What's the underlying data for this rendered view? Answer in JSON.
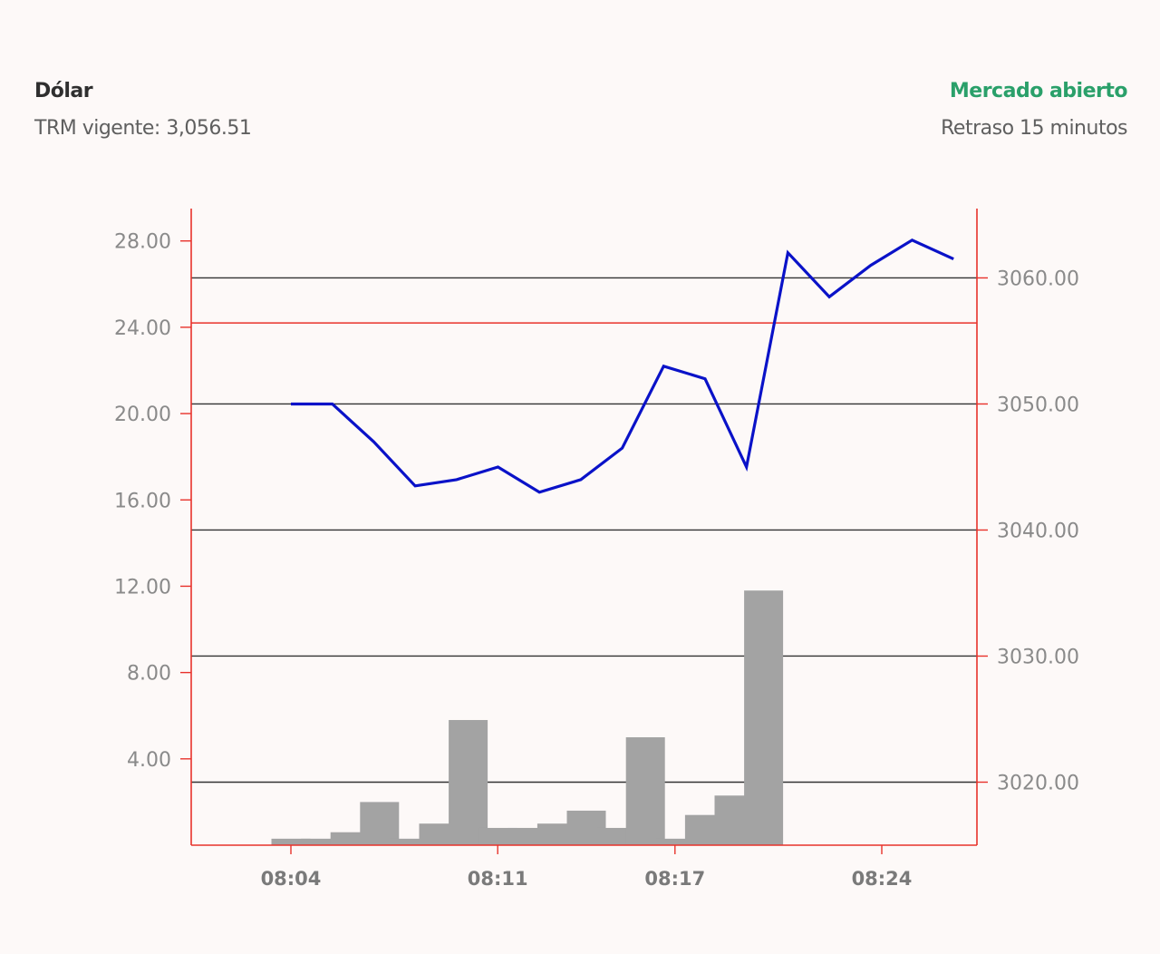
{
  "header": {
    "title": "Dólar",
    "trm": "TRM vigente: 3,056.51",
    "status": "Mercado abierto",
    "delay": "Retraso 15 minutos"
  },
  "colors": {
    "status": "#2aa06a",
    "line": "#0a12c8",
    "bars": "#a3a3a3",
    "axis": "#e8322b",
    "grid": "#333333",
    "tick_text": "#8a8a8a"
  },
  "chart_data": {
    "type": "bar+line",
    "x": [
      "08:04",
      "08:05",
      "08:06",
      "08:07",
      "08:08",
      "08:09",
      "08:10",
      "08:11",
      "08:12",
      "08:13",
      "08:14",
      "08:15",
      "08:16",
      "08:17",
      "08:18",
      "08:19",
      "08:20",
      "08:21",
      "08:22",
      "08:23",
      "08:24",
      "08:25"
    ],
    "x_tick_labels": [
      "08:04",
      "08:11",
      "08:17",
      "08:24"
    ],
    "bars": {
      "axis": "left",
      "x": [
        "08:04",
        "08:05",
        "08:06",
        "08:07",
        "08:08",
        "08:09",
        "08:10",
        "08:11",
        "08:12",
        "08:13",
        "08:14",
        "08:15",
        "08:16",
        "08:17",
        "08:18",
        "08:19",
        "08:20",
        "08:21",
        "08:22",
        "08:23"
      ],
      "values": [
        0.3,
        0.3,
        0.6,
        2.0,
        0.3,
        1.0,
        5.8,
        0.8,
        0.8,
        1.0,
        1.6,
        0.8,
        5.0,
        0.3,
        1.4,
        2.3,
        11.8
      ]
    },
    "line": {
      "axis": "right",
      "x": [
        "08:04",
        "08:05",
        "08:06",
        "08:07",
        "08:08",
        "08:09",
        "08:10",
        "08:11",
        "08:12",
        "08:13",
        "08:14",
        "08:15",
        "08:16",
        "08:17",
        "08:18",
        "08:19",
        "08:20",
        "08:21",
        "08:22"
      ],
      "values": [
        3050.0,
        3050.0,
        3047.0,
        3043.5,
        3044.0,
        3045.0,
        3043.0,
        3044.0,
        3046.5,
        3053.0,
        3052.0,
        3045.0,
        3062.0,
        3058.5,
        3061.0,
        3063.0,
        3061.5
      ]
    },
    "y_left": {
      "ticks": [
        "4.00",
        "8.00",
        "12.00",
        "16.00",
        "20.00",
        "24.00",
        "28.00"
      ],
      "range": [
        0,
        29.5
      ]
    },
    "y_right": {
      "ticks": [
        "3020.00",
        "3030.00",
        "3040.00",
        "3050.00",
        "3060.00"
      ],
      "range": [
        3015.0,
        3065.5
      ]
    },
    "grid": true,
    "reference_line_left": 24.2
  }
}
